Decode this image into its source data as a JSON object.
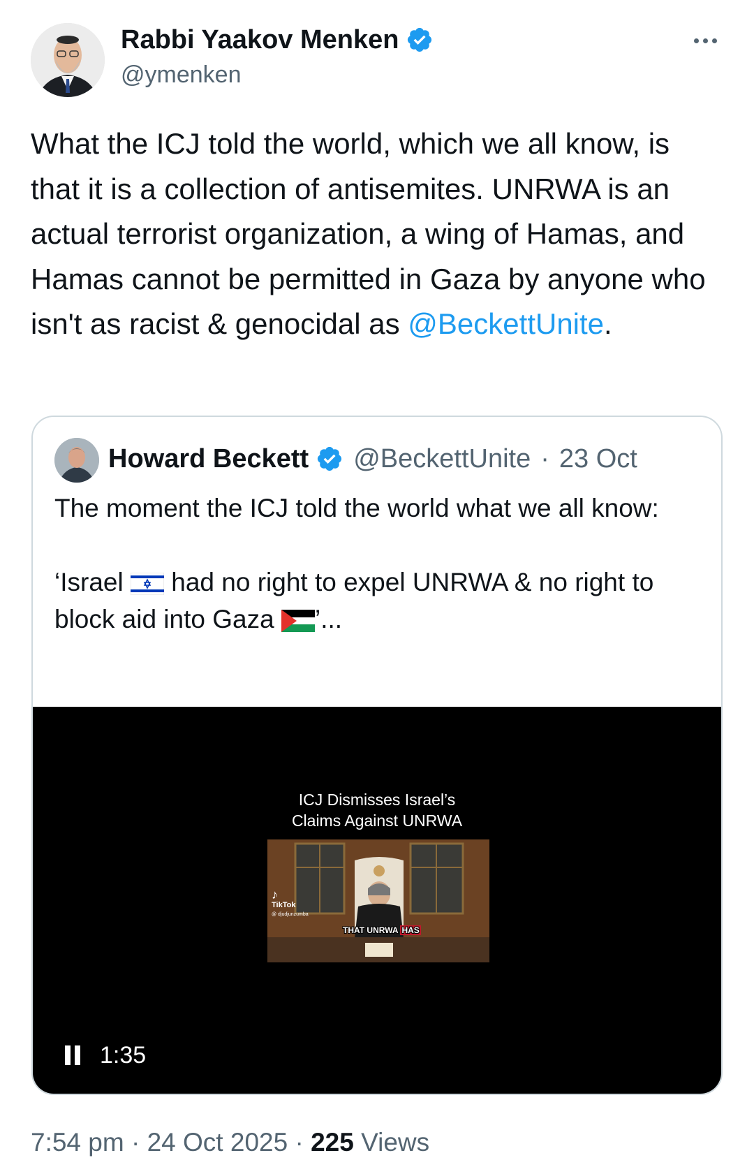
{
  "tweet": {
    "author_name": "Rabbi Yaakov Menken",
    "author_handle": "@ymenken",
    "verified": true,
    "text_before_mention": "What the ICJ told the world, which we all know, is that it is a collection of antisemites. UNRWA is an actual terrorist organization, a wing of Hamas, and Hamas cannot be permitted in Gaza by anyone who isn't as racist & genocidal as ",
    "mention": "@BeckettUnite",
    "text_after_mention": ".",
    "time": "7:54 pm",
    "date": "24 Oct 2025",
    "views_count": "225",
    "views_label": "Views",
    "separator": "·"
  },
  "quote": {
    "author_name": "Howard Beckett",
    "author_handle": "@BeckettUnite",
    "date": "23 Oct",
    "separator": "·",
    "verified": true,
    "line1": "The moment the ICJ told the world what we all know:",
    "line2_a": "‘Israel",
    "line2_b": "had no right to expel UNRWA & no right to block aid into Gaza",
    "line2_c": "’...",
    "video": {
      "title_line1": "ICJ Dismisses Israel’s",
      "title_line2": "Claims Against UNRWA",
      "watermark_app": "TikTok",
      "watermark_user": "@ djudjunzumba",
      "caption_a": "THAT UNRWA",
      "caption_b": "HAS",
      "duration": "1:35"
    }
  },
  "colors": {
    "accent": "#1d9bf0",
    "text": "#0f1419",
    "muted": "#536471",
    "border": "#cfd9de"
  }
}
